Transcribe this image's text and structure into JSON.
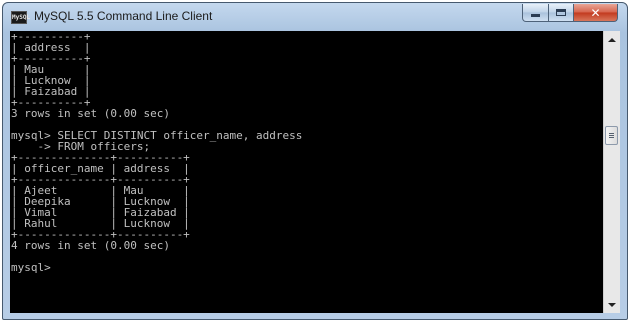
{
  "window": {
    "title": "MySQL 5.5 Command Line Client",
    "icon_label": "MySQL",
    "controls": {
      "minimize": "minimize",
      "maximize": "maximize",
      "close": "✕"
    }
  },
  "console": {
    "lines": [
      "+----------+",
      "| address  |",
      "+----------+",
      "| Mau      |",
      "| Lucknow  |",
      "| Faizabad |",
      "+----------+",
      "3 rows in set (0.00 sec)",
      "",
      "mysql> SELECT DISTINCT officer_name, address",
      "    -> FROM officers;",
      "+--------------+----------+",
      "| officer_name | address  |",
      "+--------------+----------+",
      "| Ajeet        | Mau      |",
      "| Deepika      | Lucknow  |",
      "| Vimal        | Faizabad |",
      "| Rahul        | Lucknow  |",
      "+--------------+----------+",
      "4 rows in set (0.00 sec)",
      "",
      "mysql> "
    ]
  },
  "colors": {
    "console_background": "#000000",
    "console_text": "#c0c0c0",
    "titlebar": "#b7cde6",
    "close_button": "#c2391e"
  }
}
